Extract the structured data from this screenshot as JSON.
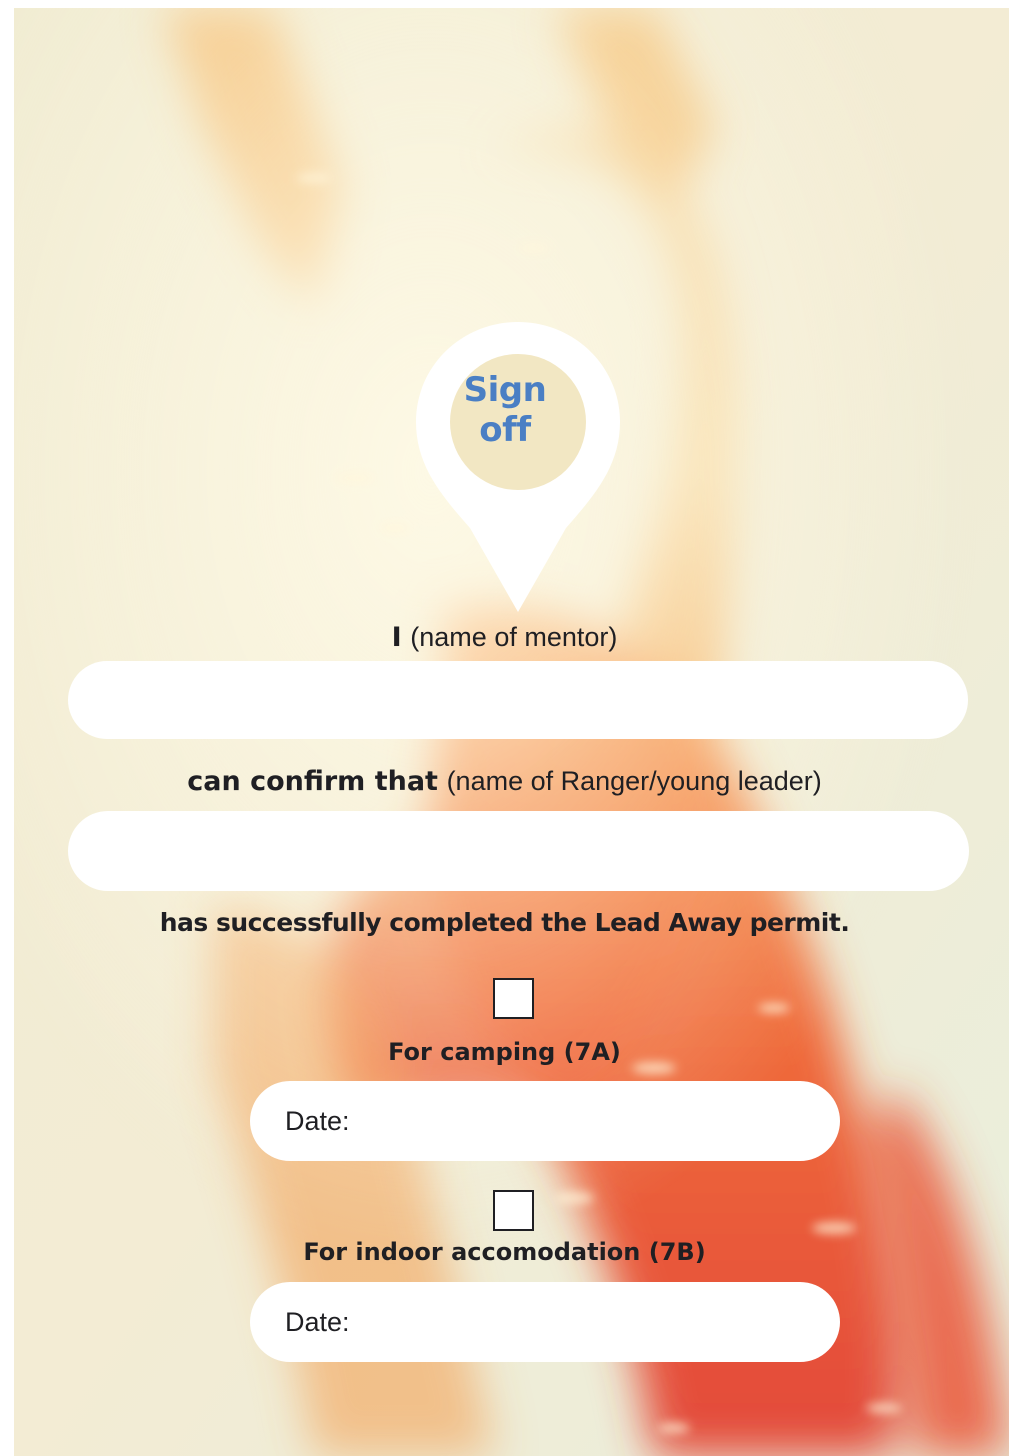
{
  "signoff": {
    "line1": "Sign",
    "line2": "off",
    "icon": "map-pin-icon"
  },
  "mentor": {
    "label_strong": "I",
    "label_hint": "(name of mentor)",
    "value": ""
  },
  "ranger": {
    "label_strong": "can confirm that",
    "label_hint": "(name of Ranger/young leader)",
    "value": ""
  },
  "statement": "has successfully completed the Lead Away permit.",
  "option_camping": {
    "checked": false,
    "label": "For camping (7A)",
    "date_label": "Date:"
  },
  "option_indoor": {
    "checked": false,
    "label": "For indoor accomodation (7B)",
    "date_label": "Date:"
  },
  "colors": {
    "accent_blue": "#4a7fc4",
    "pin_circle": "#f2e7c3",
    "text": "#1f1f23",
    "field_bg": "#ffffff"
  }
}
